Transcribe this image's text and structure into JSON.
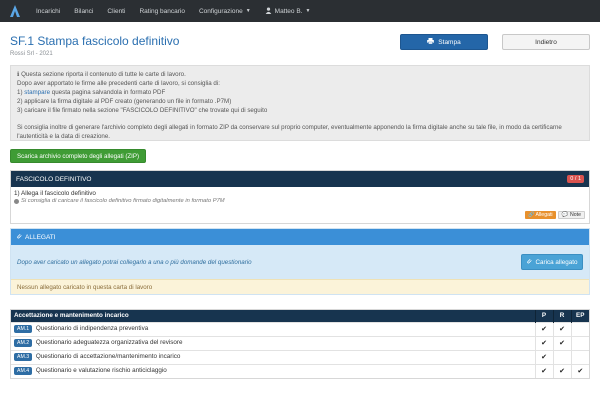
{
  "navbar": {
    "logo": "app-logo",
    "items": [
      "Incarichi",
      "Bilanci",
      "Clienti",
      "Rating bancario",
      "Configurazione"
    ],
    "user": "Matteo B."
  },
  "page": {
    "title": "SF.1 Stampa fascicolo definitivo",
    "subtitle": "Rossi Srl - 2021",
    "print_button": "Stampa",
    "back_button": "Indietro"
  },
  "info": {
    "line1": "Questa sezione riporta il contenuto di tutte le carte di lavoro.",
    "line2": "Dopo aver apportato le firme alle precedenti carte di lavoro, si consiglia di:",
    "step1_num": "1)",
    "step1_link": "stampare",
    "step1_rest": "questa pagina salvandola in formato PDF",
    "step2": "2) applicare la firma digitale al PDF creato (generando un file in formato .P7M)",
    "step3": "3) caricare il file firmato nella sezione \"FASCICOLO DEFINITIVO\" che trovate qui di seguito",
    "line3": "Si consiglia inoltre di generare l'archivio completo degli allegati in formato ZIP da conservare sul proprio computer, eventualmente apponendo la firma digitale anche su tale file, in modo da certificarne l'autenticità e la data di creazione."
  },
  "zip_button": "Scarica archivio completo degli allegati (ZIP)",
  "fascicolo": {
    "header": "FASCICOLO DEFINITIVO",
    "badge": "0 / 1",
    "item_title": "1) Allega il fascicolo definitivo",
    "item_hint": "Si consiglia di caricare il fascicolo definitivo firmato digitalmente in formato P7M",
    "attach_label": "Allegati",
    "note_label": "Note"
  },
  "allegati": {
    "header": "ALLEGATI",
    "text": "Dopo aver caricato un allegato potrai collegarlo a una o più domande del questionario",
    "upload_button": "Carica allegato",
    "warning": "Nessun allegato caricato in questa carta di lavoro"
  },
  "table": {
    "title": "Accettazione e mantenimento incarico",
    "cols": [
      "P",
      "R",
      "EP"
    ],
    "rows": [
      {
        "code": "AM.1",
        "label": "Questionario di indipendenza preventiva",
        "p": "✔",
        "r": "✔",
        "ep": ""
      },
      {
        "code": "AM.2",
        "label": "Questionario adeguatezza organizzativa del revisore",
        "p": "✔",
        "r": "✔",
        "ep": ""
      },
      {
        "code": "AM.3",
        "label": "Questionario di accettazione/mantenimento incarico",
        "p": "✔",
        "r": "",
        "ep": ""
      },
      {
        "code": "AM.4",
        "label": "Questionario e valutazione rischio anticiclaggio",
        "p": "✔",
        "r": "✔",
        "ep": "✔"
      }
    ]
  },
  "colors": {
    "navbar": "#2b2f33",
    "primary": "#2466a8",
    "dark_header": "#17344f",
    "success": "#3f9c35",
    "info": "#3b8fd7",
    "danger": "#d9534f",
    "warning": "#e8912d"
  }
}
